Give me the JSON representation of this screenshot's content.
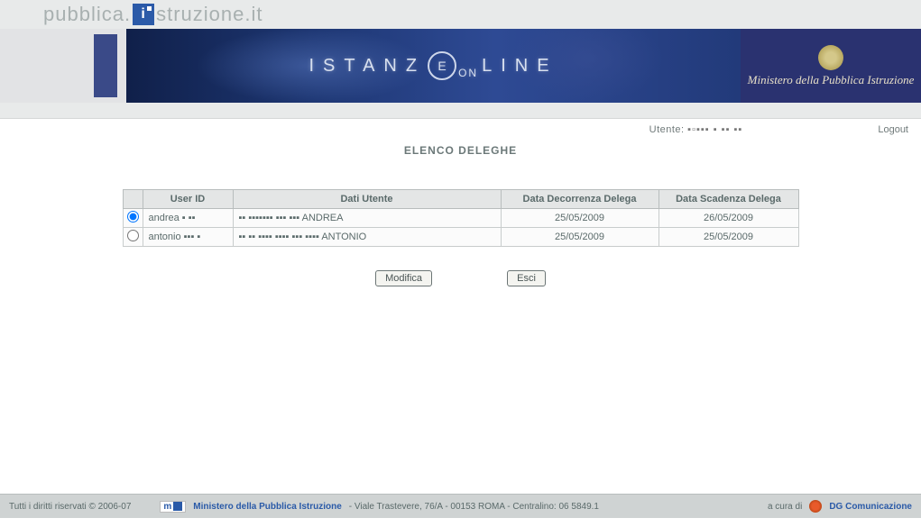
{
  "site": {
    "part1": "pubblica.",
    "part2": "struzione",
    "part3": ".it"
  },
  "banner": {
    "title_pre": "ISTANZ",
    "title_e": "E",
    "title_on": "ON",
    "title_line": "LINE",
    "ministry": "Ministero della Pubblica Istruzione"
  },
  "user_bar": {
    "label": "Utente:",
    "username_masked": "▪▫▪▪▪ ▪ ▪▪ ▪▪",
    "logout": "Logout"
  },
  "page": {
    "title": "ELENCO DELEGHE"
  },
  "table": {
    "headers": {
      "select": "",
      "user_id": "User ID",
      "dati_utente": "Dati Utente",
      "decorrenza": "Data Decorrenza Delega",
      "scadenza": "Data Scadenza Delega"
    },
    "rows": [
      {
        "selected": true,
        "user_id": "andrea ▪ ▪▪",
        "dati_utente": "▪▪ ▪▪▪▪▪▪▪ ▪▪▪ ▪▪▪  ANDREA",
        "decorrenza": "25/05/2009",
        "scadenza": "26/05/2009"
      },
      {
        "selected": false,
        "user_id": "antonio ▪▪▪ ▪",
        "dati_utente": "▪▪ ▪▪ ▪▪▪▪ ▪▪▪▪ ▪▪▪ ▪▪▪▪  ANTONIO",
        "decorrenza": "25/05/2009",
        "scadenza": "25/05/2009"
      }
    ]
  },
  "buttons": {
    "modifica": "Modifica",
    "esci": "Esci"
  },
  "footer": {
    "copyright": "Tutti i diritti riservati © 2006-07",
    "mpi_label": "m",
    "ministry_link": "Ministero della Pubblica Istruzione",
    "address": " - Viale Trastevere, 76/A - 00153 ROMA - Centralino: 06 5849.1",
    "cura": "a cura di",
    "dg": "DG Comunicazione"
  }
}
